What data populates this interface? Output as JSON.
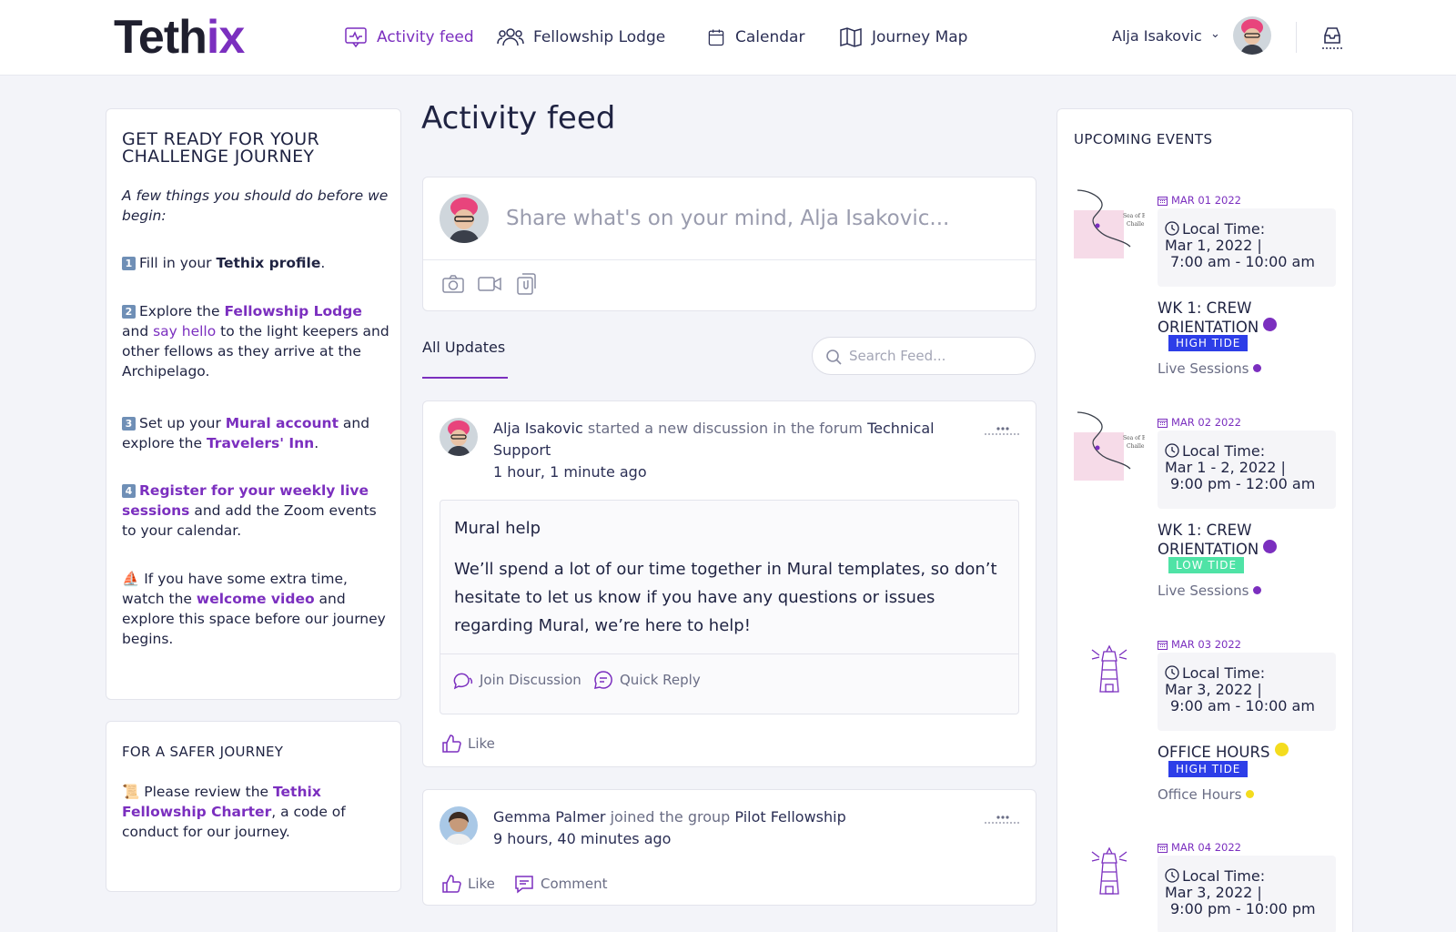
{
  "header": {
    "logo": {
      "main": "Teth",
      "accent": "ix"
    },
    "nav": [
      {
        "label": "Activity feed",
        "icon": "activity-icon",
        "active": true
      },
      {
        "label": "Fellowship Lodge",
        "icon": "users-icon",
        "active": false
      },
      {
        "label": "Calendar",
        "icon": "calendar-icon",
        "active": false
      },
      {
        "label": "Journey Map",
        "icon": "map-icon",
        "active": false
      }
    ],
    "user_name": "Alja Isakovic",
    "caret": "⌄",
    "inbox_icon": "inbox-icon"
  },
  "left": {
    "journey": {
      "title_line1": "GET READY FOR YOUR",
      "title_line2": "CHALLENGE JOURNEY",
      "intro": "A few things you should do before we begin:",
      "steps": [
        {
          "badge": "1",
          "t1": "Fill in your ",
          "b1": "Tethix profile",
          "t2": "."
        },
        {
          "badge": "2",
          "t1": "Explore the ",
          "l1": "Fellowship Lodge",
          "t2": " and ",
          "l2": "say hello",
          "t3": " to the light keepers and other fellows as they arrive at the Archipelago."
        },
        {
          "badge": "3",
          "t1": "Set up your ",
          "l1": "Mural account",
          "t2": " and explore the ",
          "l2": "Travelers' Inn",
          "t3": "."
        },
        {
          "badge": "4",
          "l1": "Register for your weekly live sessions",
          "t1": " and add the Zoom events to your calendar."
        },
        {
          "emoji": "⛵",
          "t1": " If you have some extra time, watch the ",
          "l1": "welcome video",
          "t2": " and explore this space before our journey begins."
        }
      ]
    },
    "safer": {
      "title": "FOR A SAFER JOURNEY",
      "emoji": "📜",
      "t1": " Please review the ",
      "l1": "Tethix Fellowship Charter",
      "t2": ", a code of conduct for our journey."
    }
  },
  "center": {
    "title": "Activity feed",
    "composer_placeholder": "Share what's on your mind, Alja Isakovic...",
    "tab": "All Updates",
    "search_placeholder": "Search Feed...",
    "posts": [
      {
        "author": "Alja Isakovic",
        "action": " started a new discussion in the forum ",
        "target": "Technical Support",
        "time": "1 hour, 1 minute ago",
        "inner_title": "Mural help",
        "inner_body": "We’ll spend a lot of our time together in Mural templates, so don’t hesitate to let us know if you have any questions or issues regarding Mural, we’re here to help!",
        "join": "Join Discussion",
        "reply": "Quick Reply",
        "like": "Like"
      },
      {
        "author": "Gemma Palmer",
        "action": " joined the group ",
        "target": "Pilot Fellowship",
        "time": "9 hours, 40 minutes ago",
        "like": "Like",
        "comment": "Comment"
      }
    ]
  },
  "right": {
    "title": "UPCOMING EVENTS",
    "events": [
      {
        "date": "MAR 01 2022",
        "label": "Local Time:",
        "line2": "Mar 1, 2022  |",
        "line3": "7:00 am - 10:00 am",
        "name": "WK 1: CREW ORIENTATION",
        "dot": "#7b2fbf",
        "tide": "HIGH TIDE",
        "tide_color": "#2d3ee8",
        "category": "Live Sessions",
        "cat_dot": "#7b2fbf",
        "thumb": "map"
      },
      {
        "date": "MAR 02 2022",
        "label": "Local Time:",
        "line2": "Mar 1 - 2, 2022  |",
        "line3": "9:00 pm - 12:00 am",
        "name": "WK 1: CREW ORIENTATION",
        "dot": "#7b2fbf",
        "tide": "LOW TIDE",
        "tide_color": "#4fe3a6",
        "category": "Live Sessions",
        "cat_dot": "#7b2fbf",
        "thumb": "map"
      },
      {
        "date": "MAR 03 2022",
        "label": "Local Time:",
        "line2": "Mar 3, 2022  |",
        "line3": "9:00 am - 10:00 am",
        "name": "OFFICE HOURS",
        "dot": "#f4dc1e",
        "tide": "HIGH TIDE",
        "tide_color": "#2d3ee8",
        "category": "Office Hours",
        "cat_dot": "#f4dc1e",
        "thumb": "lighthouse"
      },
      {
        "date": "MAR 04 2022",
        "label": "Local Time:",
        "line2": "Mar 3, 2022  |",
        "line3": "9:00 pm - 10:00 pm",
        "thumb": "lighthouse"
      }
    ]
  }
}
